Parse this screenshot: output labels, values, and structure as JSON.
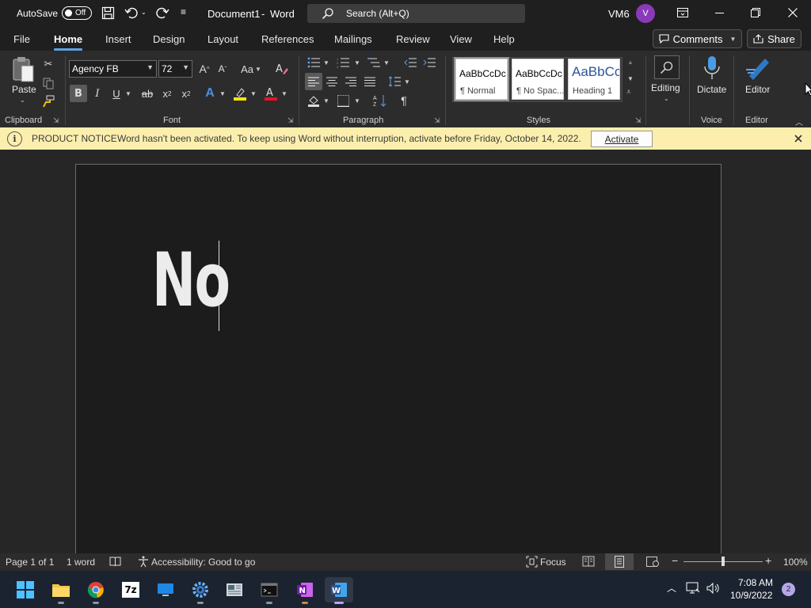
{
  "titlebar": {
    "autosave_label": "AutoSave",
    "autosave_state": "Off",
    "doc_title": "Document1",
    "separator": "-",
    "app_name": "Word",
    "search_placeholder": "Search (Alt+Q)",
    "user_name": "VM6",
    "avatar_initial": "V"
  },
  "menu": {
    "tabs": [
      "File",
      "Home",
      "Insert",
      "Design",
      "Layout",
      "References",
      "Mailings",
      "Review",
      "View",
      "Help"
    ],
    "active_tab": "Home",
    "comments_label": "Comments",
    "share_label": "Share"
  },
  "ribbon": {
    "clipboard": {
      "paste_label": "Paste",
      "group_label": "Clipboard"
    },
    "font": {
      "font_name": "Agency FB",
      "font_size": "72",
      "group_label": "Font",
      "bold": "B",
      "italic": "I",
      "underline": "U",
      "strike": "ab",
      "subscript": "x",
      "superscript": "x",
      "change_case": "Aa",
      "grow": "A",
      "shrink": "A",
      "font_color_letter": "A",
      "highlight_color": "#ffe600",
      "font_color": "#e81123",
      "text_effects_color": "#4a90e2"
    },
    "paragraph": {
      "group_label": "Paragraph",
      "show_marks": "¶"
    },
    "styles": {
      "group_label": "Styles",
      "cards": [
        {
          "preview": "AaBbCcDc",
          "name": "¶ Normal"
        },
        {
          "preview": "AaBbCcDc",
          "name": "¶ No Spac..."
        },
        {
          "preview": "AaBbCc",
          "name": "Heading 1"
        }
      ]
    },
    "editing": {
      "label": "Editing"
    },
    "voice": {
      "dictate_label": "Dictate",
      "group_label": "Voice"
    },
    "editor": {
      "label": "Editor",
      "group_label": "Editor"
    }
  },
  "notice": {
    "title": "PRODUCT NOTICE",
    "message": "Word hasn't been activated. To keep using Word without interruption, activate before Friday, October 14, 2022.",
    "activate_label": "Activate"
  },
  "document": {
    "text": "No"
  },
  "status": {
    "page": "Page 1 of 1",
    "words": "1 word",
    "accessibility": "Accessibility: Good to go",
    "focus_label": "Focus",
    "zoom": "100%",
    "zoom_level": 0.5
  },
  "taskbar": {
    "time": "7:08 AM",
    "date": "10/9/2022",
    "notification_count": "2",
    "seven_zip_label": "7z"
  },
  "colors": {
    "accent": "#5ea1e4",
    "notice_bg": "#fcefae",
    "word_blue": "#2b579a",
    "onenote_purple": "#7719aa"
  }
}
